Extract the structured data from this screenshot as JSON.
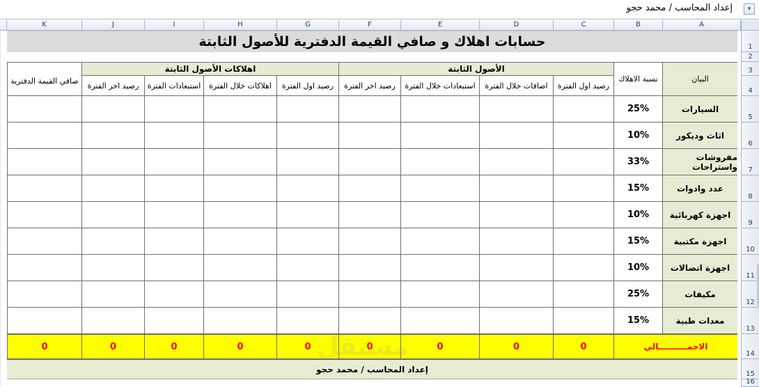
{
  "formula_bar": {
    "text": "إعداد المحاسب / محمد حجو"
  },
  "columns": [
    "K",
    "J",
    "I",
    "H",
    "G",
    "F",
    "E",
    "D",
    "C",
    "B",
    "A"
  ],
  "rows": [
    "1",
    "2",
    "3",
    "4",
    "5",
    "6",
    "7",
    "8",
    "9",
    "10",
    "11",
    "12",
    "13",
    "14",
    "15",
    "16"
  ],
  "title": "حسابات اهلاك و صافي القيمة الدفترية للأصول الثابتة",
  "headers": {
    "statement": "البيان",
    "depreciation_rate": "نسبة الاهلاك",
    "fixed_assets_group": "الأصول الثابتة",
    "depreciation_group": "اهلاكات الأصول الثابتة",
    "net_book_value": "صافي القيمة الدفترية",
    "fa_opening": "رصيد اول الفترة",
    "fa_additions": "اضافات خلال الفترة",
    "fa_disposals": "استبعادات خلال الفترة",
    "fa_closing": "رصيد اخر الفترة",
    "dep_opening": "رصيد اول الفترة",
    "dep_during": "اهلاكات خلال الفترة",
    "dep_disposals": "استبعادات الفترة",
    "dep_closing": "رصيد اخر الفترة"
  },
  "items": [
    {
      "name": "السيارات",
      "rate": "25%"
    },
    {
      "name": "اثاث وديكور",
      "rate": "10%"
    },
    {
      "name": "مفروشات واستراحات",
      "rate": "33%"
    },
    {
      "name": "عدد وادوات",
      "rate": "15%"
    },
    {
      "name": "اجهزة كهربائية",
      "rate": "10%"
    },
    {
      "name": "اجهزة مكتبية",
      "rate": "15%"
    },
    {
      "name": "اجهزة اتصالات",
      "rate": "10%"
    },
    {
      "name": "مكيفات",
      "rate": "25%"
    },
    {
      "name": "معدات طبية",
      "rate": "15%"
    }
  ],
  "totals": {
    "label": "الاجمــــــــــالي",
    "fa_opening": "0",
    "fa_additions": "0",
    "fa_disposals": "0",
    "fa_closing": "0",
    "dep_opening": "0",
    "dep_during": "0",
    "dep_disposals": "0",
    "dep_closing": "0",
    "net_book_value": "0"
  },
  "footer": "إعداد المحاسب / محمد حجو",
  "watermark": "مستقل"
}
